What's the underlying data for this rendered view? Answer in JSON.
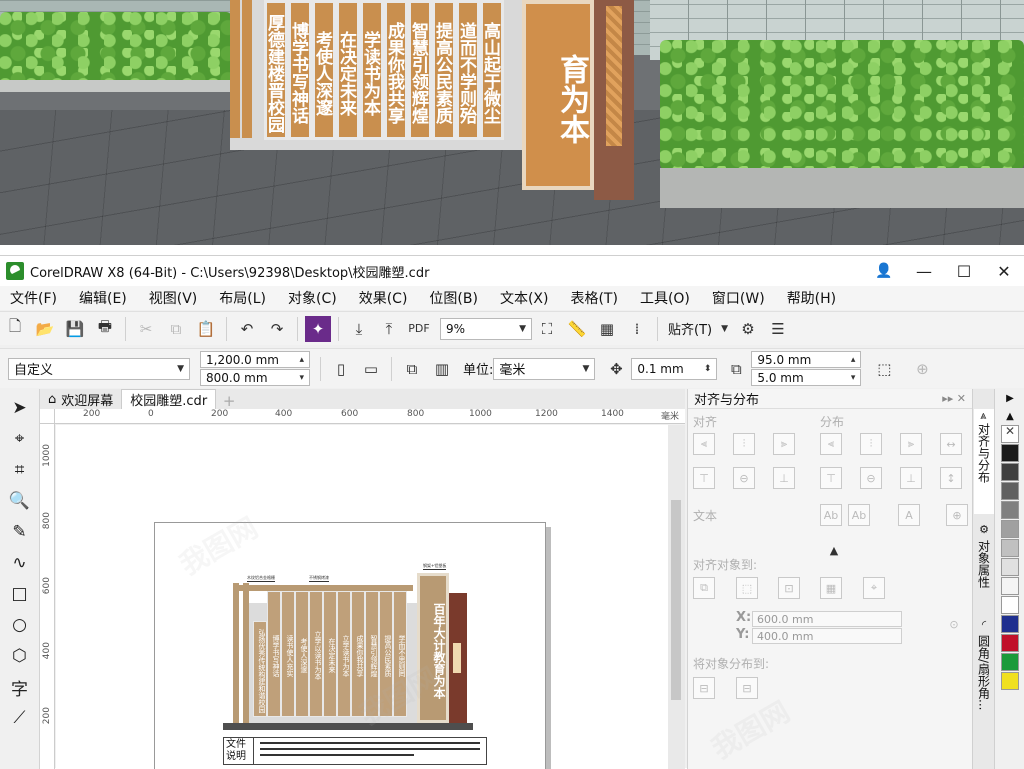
{
  "photo": {
    "slats": [
      "厚德建楼晋校园",
      "博学书写神话",
      "考使人深邃",
      "在决定未来",
      "学读书为本",
      "成果你我共享",
      "智慧引领辉煌",
      "提高公民素质",
      "道而不学则殆",
      "高山起于微尘"
    ],
    "big_text": "育为本"
  },
  "titlebar": {
    "title": "CorelDRAW X8 (64-Bit) - C:\\Users\\92398\\Desktop\\校园雕塑.cdr",
    "minimize": "—",
    "maximize": "☐",
    "close": "✕",
    "user_icon": "user-account-icon"
  },
  "menu": [
    "文件(F)",
    "编辑(E)",
    "视图(V)",
    "布局(L)",
    "对象(C)",
    "效果(C)",
    "位图(B)",
    "文本(X)",
    "表格(T)",
    "工具(O)",
    "窗口(W)",
    "帮助(H)"
  ],
  "std_toolbar": {
    "pdf": "PDF",
    "zoom": "9%",
    "snap": "贴齐(T)"
  },
  "prop_toolbar": {
    "preset": "自定义",
    "width": "1,200.0 mm",
    "height": "800.0 mm",
    "unit_label": "单位:",
    "unit": "毫米",
    "nudge": "0.1 mm",
    "dup_x": "95.0 mm",
    "dup_y": "5.0 mm"
  },
  "doc_tabs": {
    "home": "欢迎屏幕",
    "doc": "校园雕塑.cdr"
  },
  "ruler": {
    "h_labels": [
      "200",
      "0",
      "200",
      "400",
      "600",
      "800",
      "1000",
      "1200",
      "1400"
    ],
    "unit": "毫米",
    "v_labels": [
      "1000",
      "800",
      "600",
      "400",
      "200"
    ]
  },
  "design": {
    "tower_text": "百年大计教育为本",
    "panels": [
      "弘扬优秀传统构建和谐校园",
      "博学书写神话",
      "读书使人充实",
      "考使人深邃",
      "立学以读书为本",
      "在决定未来",
      "立学读书为本",
      "成果你我共享",
      "智慧引领辉煌",
      "提高公民素质",
      "学而不思则罔",
      "思而不学则殆",
      "千里始于足下",
      "高山起于微尘"
    ],
    "info_label": "文件\n说明",
    "notes": [
      "木纹铝合金格栅",
      "不锈钢烤漆",
      "钢架+铝塑板"
    ]
  },
  "docker": {
    "title": "对齐与分布",
    "sec_align": "对齐",
    "sec_distribute": "分布",
    "sec_text": "文本",
    "align_to": "对齐对象到:",
    "x": "600.0 mm",
    "y": "400.0 mm",
    "distribute_to": "将对象分布到:"
  },
  "vtabs": [
    "对齐与分布",
    "对象属性",
    "圆角/扇形角..."
  ],
  "palette": [
    "#ffffff",
    "#1a1a1a",
    "#404040",
    "#606060",
    "#808080",
    "#a0a0a0",
    "#c0c0c0",
    "#e0e0e0",
    "#f4f4f4",
    "#ffffff",
    "#1f2f8f",
    "#c0102a",
    "#1a9a3a",
    "#f0e020"
  ],
  "watermark": "我图网"
}
